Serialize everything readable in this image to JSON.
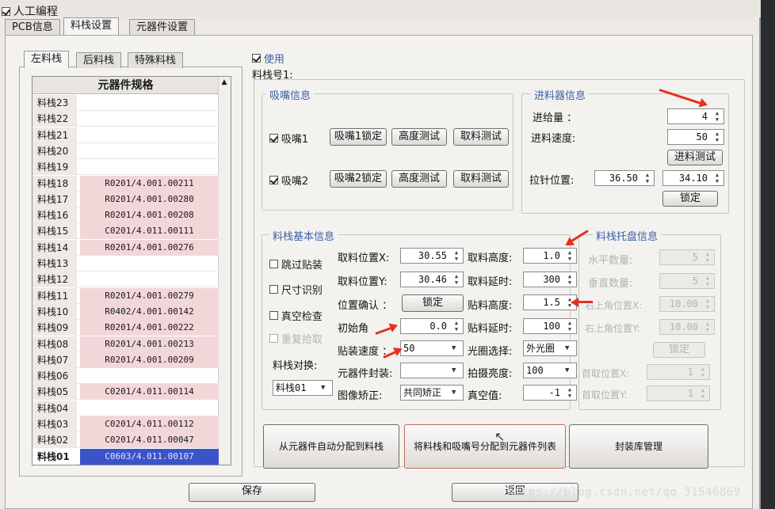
{
  "window": {
    "manual_programming_label": "人工编程",
    "top_tabs": [
      "PCB信息",
      "料栈设置",
      "元器件设置"
    ],
    "sub_tabs": [
      "左料栈",
      "后料栈",
      "特殊料栈"
    ]
  },
  "feeder_list": {
    "header": "元器件规格",
    "rows": [
      {
        "name": "料栈23",
        "spec": ""
      },
      {
        "name": "料栈22",
        "spec": ""
      },
      {
        "name": "料栈21",
        "spec": ""
      },
      {
        "name": "料栈20",
        "spec": ""
      },
      {
        "name": "料栈19",
        "spec": ""
      },
      {
        "name": "料栈18",
        "spec": "R0201/4.001.00211"
      },
      {
        "name": "料栈17",
        "spec": "R0201/4.001.00280"
      },
      {
        "name": "料栈16",
        "spec": "R0201/4.001.00208"
      },
      {
        "name": "料栈15",
        "spec": "C0201/4.011.00111"
      },
      {
        "name": "料栈14",
        "spec": "R0201/4.001.00276"
      },
      {
        "name": "料栈13",
        "spec": ""
      },
      {
        "name": "料栈12",
        "spec": ""
      },
      {
        "name": "料栈11",
        "spec": "R0201/4.001.00279"
      },
      {
        "name": "料栈10",
        "spec": "R0402/4.001.00142"
      },
      {
        "name": "料栈09",
        "spec": "R0201/4.001.00222"
      },
      {
        "name": "料栈08",
        "spec": "R0201/4.001.00213"
      },
      {
        "name": "料栈07",
        "spec": "R0201/4.001.00209"
      },
      {
        "name": "料栈06",
        "spec": ""
      },
      {
        "name": "料栈05",
        "spec": "C0201/4.011.00114"
      },
      {
        "name": "料栈04",
        "spec": ""
      },
      {
        "name": "料栈03",
        "spec": "C0201/4.011.00112"
      },
      {
        "name": "料栈02",
        "spec": "C0201/4.011.00047"
      },
      {
        "name": "料栈01",
        "spec": "C0603/4.011.00107"
      }
    ]
  },
  "settings": {
    "use_label": "使用",
    "feeder_no_label": "料栈号1:",
    "nozzle_info": {
      "legend": "吸嘴信息",
      "nozzle1": {
        "label": "吸嘴1",
        "lock": "吸嘴1锁定",
        "height": "高度测试",
        "pick": "取料测试"
      },
      "nozzle2": {
        "label": "吸嘴2",
        "lock": "吸嘴2锁定",
        "height": "高度测试",
        "pick": "取料测试"
      }
    },
    "feeder_info": {
      "legend": "进料器信息",
      "feed_amount_label": "进给量 ：",
      "feed_amount": "4",
      "feed_speed_label": "进料速度:",
      "feed_speed": "50",
      "feed_test": "进料测试",
      "pin_pos_label": "拉针位置:",
      "pin_x": "36.50",
      "pin_y": "34.10",
      "lock": "锁定"
    },
    "basic_info": {
      "legend": "料栈基本信息",
      "skip_mount": "跳过贴装",
      "size_detect": "尺寸识别",
      "vacuum_check": "真空检查",
      "repeat_pick": "重复拾取",
      "feeder_swap_label": "料栈对换:",
      "feeder_swap_value": "料栈01",
      "pick_x_label": "取料位置X:",
      "pick_x": "30.55",
      "pick_y_label": "取料位置Y:",
      "pick_y": "30.46",
      "pos_confirm_label": "位置确认 ：",
      "pos_confirm_btn": "锁定",
      "init_angle_label": "初始角",
      "init_angle": "0.0",
      "mount_speed_label": "贴装速度 ：",
      "mount_speed": "50",
      "package_label": "元器件封装:",
      "package": "",
      "image_correct_label": "图像矫正:",
      "image_correct": "共同矫正",
      "pick_height_label": "取料高度:",
      "pick_height": "1.0",
      "pick_delay_label": "取料延时:",
      "pick_delay": "300",
      "mount_height_label": "贴料高度:",
      "mount_height": "1.5",
      "mount_delay_label": "贴料延时:",
      "mount_delay": "100",
      "aperture_label": "光圈选择:",
      "aperture": "外光圈",
      "brightness_label": "拍摄亮度:",
      "brightness": "100",
      "vacuum_label": "真空值:",
      "vacuum": "-1"
    },
    "tray_info": {
      "legend": "料栈托盘信息",
      "h_count_label": "水平数量:",
      "h_count": "5",
      "v_count_label": "垂直数量:",
      "v_count": "5",
      "tr_x_label": "右上角位置X:",
      "tr_x": "10.00",
      "tr_y_label": "右上角位置Y:",
      "tr_y": "10.00",
      "lock": "锁定",
      "first_x_label": "首取位置X:",
      "first_x": "1",
      "first_y_label": "首取位置Y:",
      "first_y": "1"
    },
    "actions": {
      "auto_assign": "从元器件自动分配到料栈",
      "assign_to_list": "将料栈和吸嘴号分配到元器件列表",
      "package_lib": "封装库管理"
    }
  },
  "footer": {
    "save": "保存",
    "return": "返回"
  },
  "watermark": "https://blog.csdn.net/qq_31546869"
}
